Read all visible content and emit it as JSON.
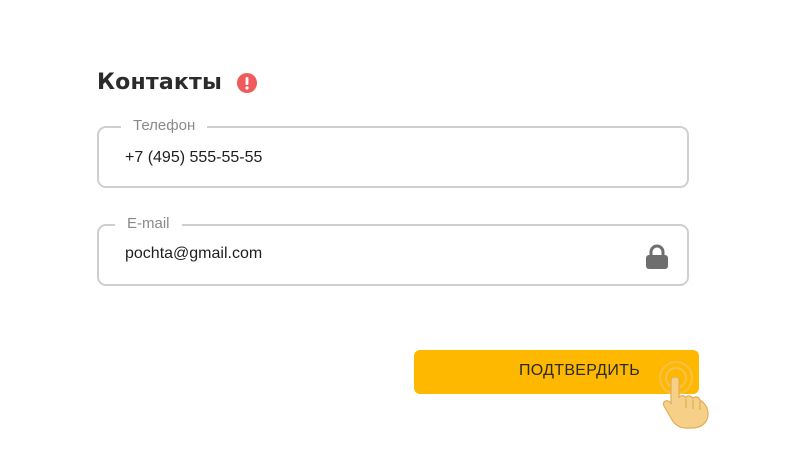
{
  "section": {
    "title": "Контакты",
    "warning_icon": "exclamation-circle-icon",
    "warning_color": "#f05a5a"
  },
  "phone_field": {
    "label": "Телефон",
    "value": "+7 (495) 555-55-55"
  },
  "email_field": {
    "label": "E-mail",
    "value": "pochta@gmail.com",
    "lock_icon": "lock-icon",
    "locked": true
  },
  "submit": {
    "label": "ПОДТВЕРДИТЬ",
    "color": "#ffb800",
    "pointer_icon": "hand-pointer-icon"
  },
  "colors": {
    "border": "#cfcfcf",
    "label": "#8a8a8a",
    "text": "#1e1e1e"
  }
}
